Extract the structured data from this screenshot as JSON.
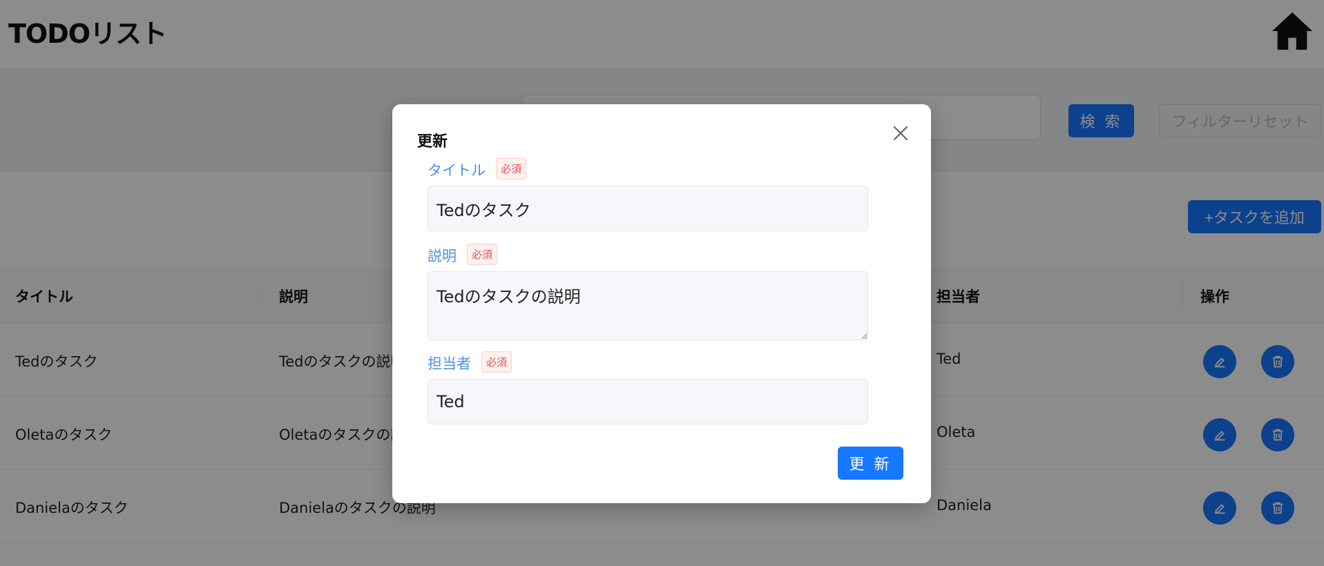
{
  "app": {
    "title": "TODOリスト"
  },
  "filter": {
    "search_value": "",
    "search_button": "検 索",
    "reset_button": "フィルターリセット"
  },
  "toolbar": {
    "add_button": "+タスクを追加"
  },
  "table": {
    "columns": [
      "タイトル",
      "説明",
      "担当者",
      "操作"
    ],
    "rows": [
      {
        "title": "Tedのタスク",
        "description": "Tedのタスクの説明",
        "assignee": "Ted"
      },
      {
        "title": "Oletaのタスク",
        "description": "Oletaのタスクの説明",
        "assignee": "Oleta"
      },
      {
        "title": "Danielaのタスク",
        "description": "Danielaのタスクの説明",
        "assignee": "Daniela"
      }
    ]
  },
  "modal": {
    "title": "更新",
    "required_badge": "必須",
    "fields": {
      "title": {
        "label": "タイトル",
        "value": "Tedのタスク"
      },
      "description": {
        "label": "説明",
        "value": "Tedのタスクの説明"
      },
      "assignee": {
        "label": "担当者",
        "value": "Ted"
      }
    },
    "submit_button": "更 新"
  },
  "colors": {
    "primary": "#1677ff",
    "label": "#4a90e2",
    "required": "#e05353"
  },
  "icons": {
    "home": "home-icon",
    "close": "close-icon",
    "edit": "pencil-icon",
    "delete": "trash-icon"
  }
}
